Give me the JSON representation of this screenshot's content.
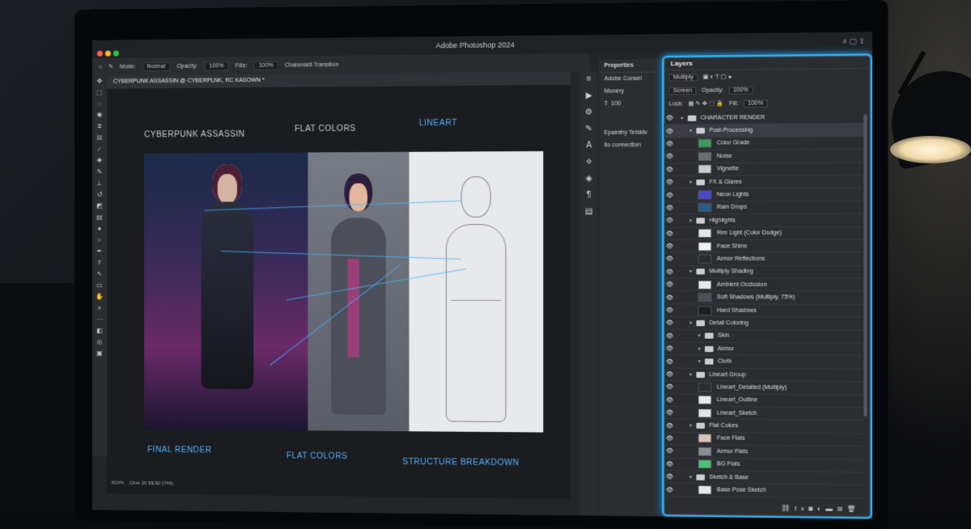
{
  "app": {
    "title": "Adobe Photoshop 2024",
    "doc_tab": "CYBERPUNK ASSASSIN @ CYBERPLNK, RC KASOWN *"
  },
  "options_bar": {
    "mode_label": "Mode:",
    "mode_value": "Normal",
    "opacity_label": "Opacity:",
    "opacity_value": "100%",
    "fill_label": "Fills:",
    "fill_value": "100%",
    "extra": "Chalonsktt Transition"
  },
  "canvas": {
    "headers": [
      "CYBERPUNK ASSASSIN",
      "FLAT COLORS",
      "LINEART"
    ],
    "footers": [
      "FINAL RENDER",
      "FLAT COLORS",
      "STRUCTURE BREAKDOWN"
    ]
  },
  "status_bar": {
    "zoom": "820%",
    "info": "Cber 20 $$:$2 (746)"
  },
  "properties": {
    "title": "Properties",
    "item": "Adobe Consel",
    "section": "Monery",
    "x_value": "100",
    "link1": "Epainthy Tetsktv",
    "link2": "Ilo connection"
  },
  "layers_panel": {
    "title": "Layers",
    "blend_mode": "Multiply",
    "blend_mode2": "Screen",
    "opacity_label": "Opacity:",
    "opacity_value": "100%",
    "lock_label": "Lock:",
    "fill_label": "Fill:",
    "fill_value": "100%",
    "footer_icons": "fx"
  },
  "layers": [
    {
      "name": "CHARACTER RENDER",
      "type": "group",
      "depth": 0
    },
    {
      "name": "Post-Processing",
      "type": "group",
      "depth": 1,
      "selected": true
    },
    {
      "name": "Color Grade",
      "type": "layer",
      "depth": 2,
      "thumb": "#3e9a5a"
    },
    {
      "name": "Noise",
      "type": "layer",
      "depth": 2,
      "thumb": "#6b6e73"
    },
    {
      "name": "Vignette",
      "type": "layer",
      "depth": 2,
      "thumb": "#c8cacc"
    },
    {
      "name": "FX & Glares",
      "type": "group",
      "depth": 1
    },
    {
      "name": "Neon Lights",
      "type": "layer",
      "depth": 2,
      "thumb": "#4a48c8"
    },
    {
      "name": "Rain Drops",
      "type": "layer",
      "depth": 2,
      "thumb": "#2b5a8a"
    },
    {
      "name": "Highlights",
      "type": "group",
      "depth": 1
    },
    {
      "name": "Rim Light (Color Dodge)",
      "type": "layer",
      "depth": 2,
      "thumb": "#e4e5e7"
    },
    {
      "name": "Face Shine",
      "type": "layer",
      "depth": 2,
      "thumb": "#f0f0f1"
    },
    {
      "name": "Armor Reflections",
      "type": "layer",
      "depth": 2,
      "thumb": "#2a2c30"
    },
    {
      "name": "Multiply Shading",
      "type": "group",
      "depth": 1
    },
    {
      "name": "Ambient Occlusion",
      "type": "layer",
      "depth": 2,
      "thumb": "#e6e7e9"
    },
    {
      "name": "Soft Shadows (Multiply, 75%)",
      "type": "layer",
      "depth": 2,
      "thumb": "#4c4f55"
    },
    {
      "name": "Hard Shadows",
      "type": "layer",
      "depth": 2,
      "thumb": "#1e1f22"
    },
    {
      "name": "Detail Coloring",
      "type": "group",
      "depth": 1
    },
    {
      "name": "Skin",
      "type": "group",
      "depth": 2
    },
    {
      "name": "Armor",
      "type": "group",
      "depth": 2
    },
    {
      "name": "Cloth",
      "type": "group",
      "depth": 2
    },
    {
      "name": "Lineart Group",
      "type": "group",
      "depth": 1
    },
    {
      "name": "Lineart_Detailed (Multiply)",
      "type": "layer",
      "depth": 2,
      "thumb": "#2b2d31"
    },
    {
      "name": "Lineart_Outline",
      "type": "layer",
      "depth": 2,
      "thumb": "#e8e9eb"
    },
    {
      "name": "Lineart_Sketch",
      "type": "layer",
      "depth": 2,
      "thumb": "#e2e3e5"
    },
    {
      "name": "Flat Colors",
      "type": "group",
      "depth": 1
    },
    {
      "name": "Face Flats",
      "type": "layer",
      "depth": 2,
      "thumb": "#d9c2b8"
    },
    {
      "name": "Armor Flats",
      "type": "layer",
      "depth": 2,
      "thumb": "#8a8d93"
    },
    {
      "name": "BG Flats",
      "type": "layer",
      "depth": 2,
      "thumb": "#4fbf7a"
    },
    {
      "name": "Sketch & Base",
      "type": "group",
      "depth": 1
    },
    {
      "name": "Base Pose Sketch",
      "type": "layer",
      "depth": 2,
      "thumb": "#e6e7e9"
    }
  ]
}
